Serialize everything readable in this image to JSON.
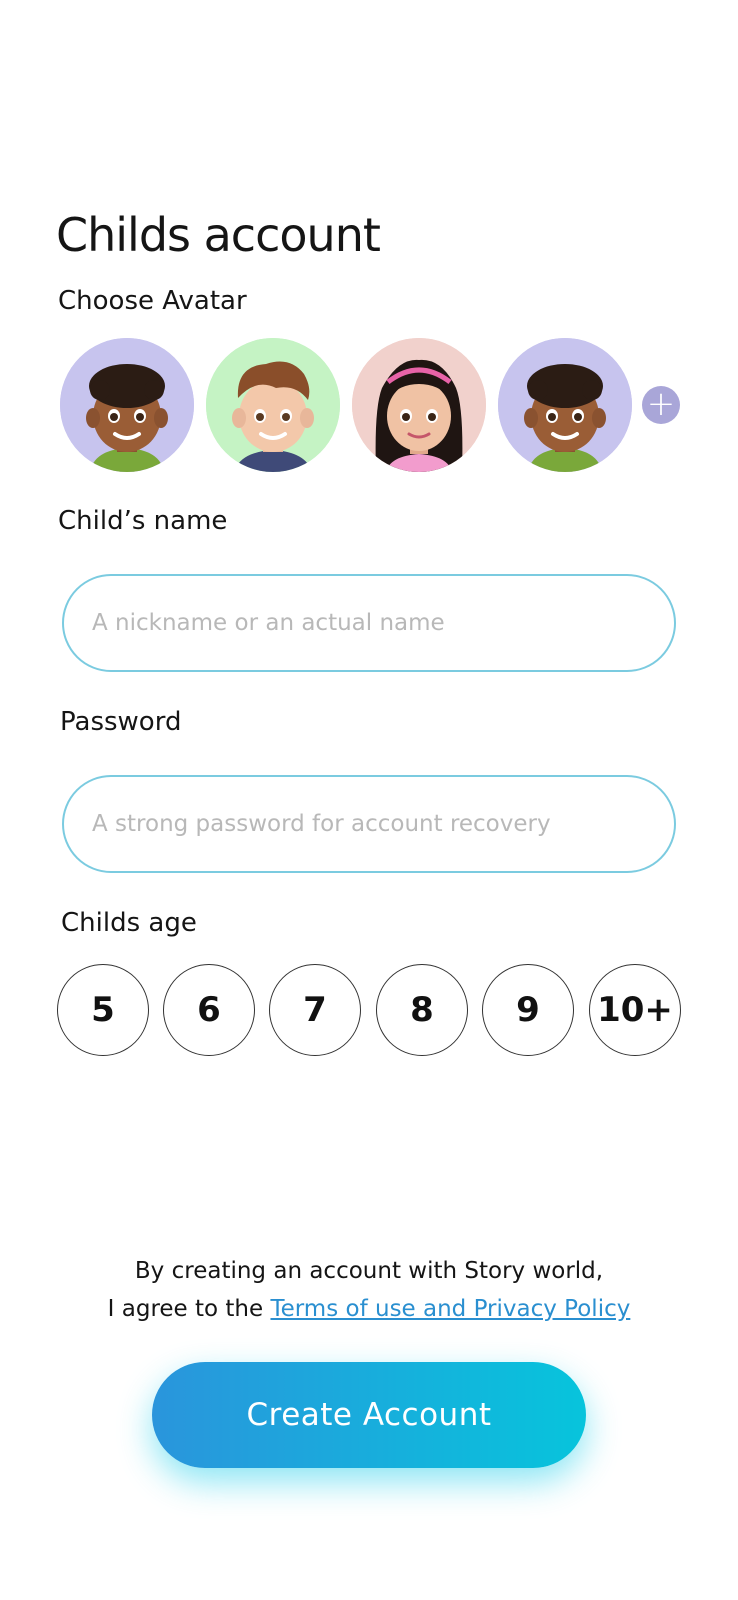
{
  "header": {
    "title": "Childs account"
  },
  "avatar_section": {
    "label": "Choose Avatar",
    "avatars": [
      {
        "name": "boy-curly-hair",
        "bg": "#c7c4ee"
      },
      {
        "name": "boy-brown-hair",
        "bg": "#c5f3c4"
      },
      {
        "name": "girl-long-hair",
        "bg": "#f1d1cc"
      },
      {
        "name": "boy-curly-hair",
        "bg": "#c7c4ee"
      }
    ],
    "add_icon": "plus-icon"
  },
  "name_field": {
    "label": "Child’s name",
    "placeholder": "A nickname or an actual name",
    "value": ""
  },
  "password_field": {
    "label": "Password",
    "placeholder": "A strong password for account recovery",
    "value": ""
  },
  "age_section": {
    "label": "Childs age",
    "options": [
      "5",
      "6",
      "7",
      "8",
      "9",
      "10+"
    ]
  },
  "terms": {
    "line1": "By creating an account with Story world,",
    "line2_prefix": "I agree to the ",
    "link": "Terms of use and Privacy Policy"
  },
  "cta": {
    "label": "Create Account"
  },
  "colors": {
    "accent_start": "#2a95dc",
    "accent_end": "#07c4dc",
    "field_border": "#7bcbe0",
    "link": "#2a8fd0"
  }
}
